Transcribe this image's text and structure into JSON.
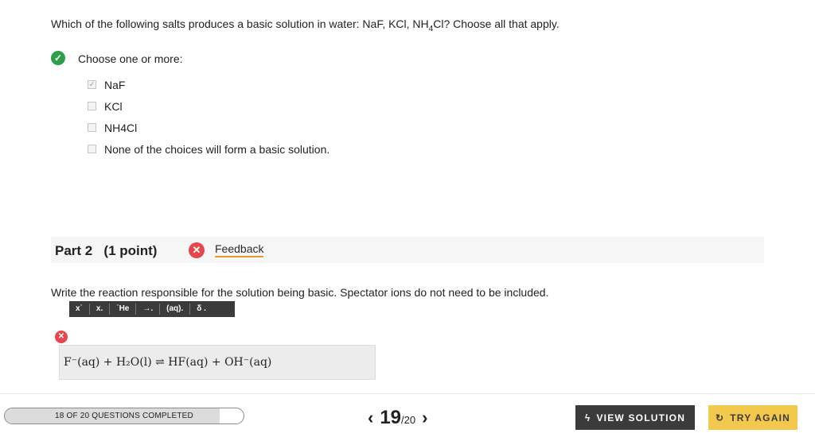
{
  "question": {
    "text_before": "Which of the following salts produces a basic solution in water: NaF, KCl, NH",
    "subscript": "4",
    "text_after": "Cl? Choose all that apply."
  },
  "part1": {
    "status_icon": "check-icon",
    "choose_label": "Choose one or more:",
    "choices": [
      {
        "label": "NaF",
        "checked": true
      },
      {
        "label": "KCl",
        "checked": false
      },
      {
        "label": "NH4Cl",
        "checked": false
      },
      {
        "label": "None of the choices will form a basic solution.",
        "checked": false
      }
    ]
  },
  "part2": {
    "title": "Part 2   (1 point)",
    "feedback_icon": "close-icon",
    "feedback_label": "Feedback",
    "prompt": "Write the reaction responsible for the solution being basic. Spectator ions do not need to be included.",
    "toolbar": [
      "x˙",
      "x.",
      "˙He",
      "→.",
      "(aq).",
      "δ ."
    ],
    "answer_status_icon": "close-icon",
    "answer": "F⁻(aq) + H₂O(l) ⇌ HF(aq) + OH⁻(aq)"
  },
  "footer": {
    "progress_text": "18 OF 20 QUESTIONS COMPLETED",
    "progress_fraction": 0.9,
    "current_page": "19",
    "total_pages": "/20",
    "prev_icon": "chevron-left-icon",
    "next_icon": "chevron-right-icon",
    "view_solution_label": "VIEW SOLUTION",
    "view_solution_icon": "bolt-icon",
    "try_again_label": "TRY AGAIN",
    "try_again_icon": "refresh-icon"
  },
  "colors": {
    "correct": "#2e9e4a",
    "incorrect": "#e5474d",
    "accent_underline": "#e59b2f",
    "try_again_bg": "#f2c94c",
    "view_solution_bg": "#3b3b3b"
  }
}
